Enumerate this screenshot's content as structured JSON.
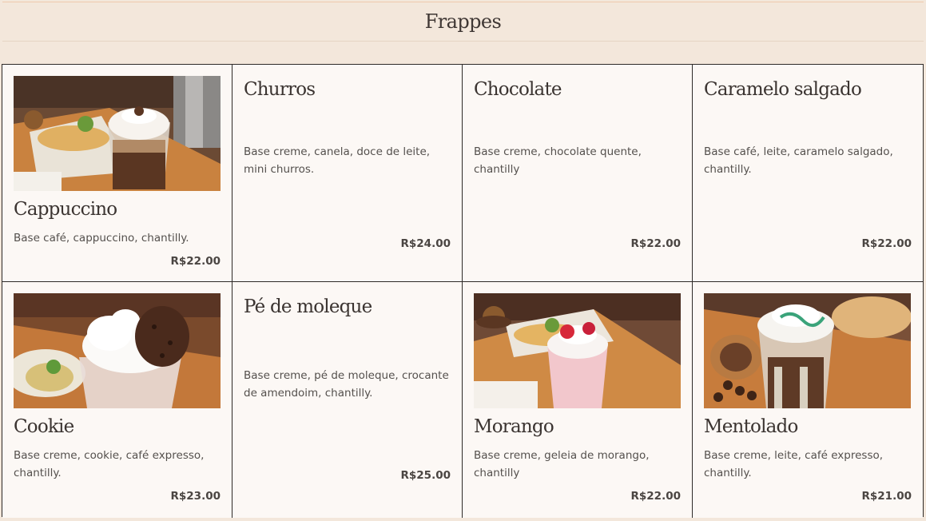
{
  "header": {
    "title": "Frappes"
  },
  "items": [
    {
      "name": "Cappuccino",
      "description": "Base café, cappuccino, chantilly.",
      "price": "R$22.00",
      "image": "cappuccino-frappe-photo"
    },
    {
      "name": "Churros",
      "description": "Base creme, canela, doce de leite, mini churros.",
      "price": "R$24.00"
    },
    {
      "name": "Chocolate",
      "description": "Base creme, chocolate quente, chantilly",
      "price": "R$22.00"
    },
    {
      "name": "Caramelo salgado",
      "description": "Base café, leite, caramelo salgado, chantilly.",
      "price": "R$22.00"
    },
    {
      "name": "Cookie",
      "description": "Base creme, cookie, café expresso, chantilly.",
      "price": "R$23.00",
      "image": "cookie-frappe-photo"
    },
    {
      "name": "Pé de moleque",
      "description": "Base creme, pé de moleque, crocante de amendoim, chantilly.",
      "price": "R$25.00"
    },
    {
      "name": "Morango",
      "description": "Base creme, geleia de morango, chantilly",
      "price": "R$22.00",
      "image": "strawberry-frappe-photo"
    },
    {
      "name": "Mentolado",
      "description": "Base creme, leite, café expresso, chantilly.",
      "price": "R$21.00",
      "image": "mint-frappe-photo"
    }
  ]
}
